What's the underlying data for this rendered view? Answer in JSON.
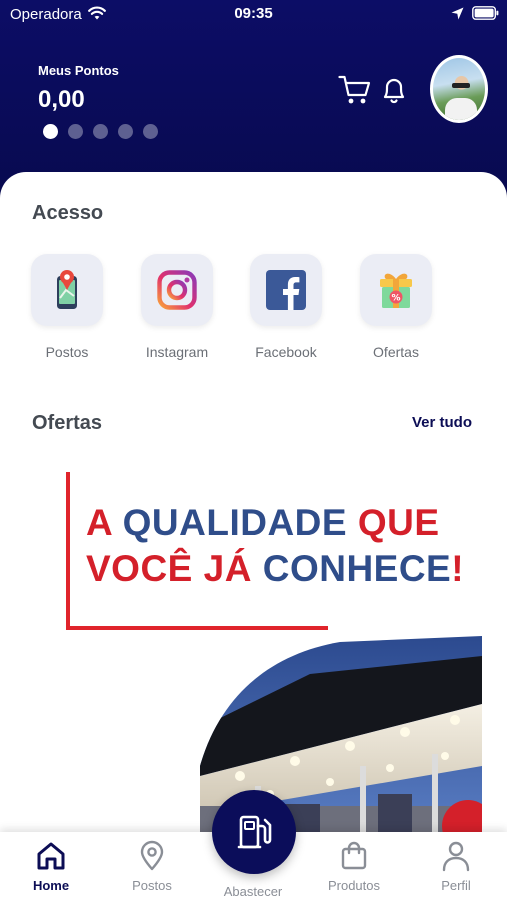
{
  "status_bar": {
    "carrier": "Operadora",
    "time": "09:35"
  },
  "header": {
    "points_label": "Meus Pontos",
    "points_value": "0,00",
    "carousel_pages": 5,
    "carousel_active": 0,
    "icons": [
      "cart-icon",
      "bell-icon"
    ],
    "avatar": "user-avatar"
  },
  "access": {
    "title": "Acesso",
    "items": [
      {
        "label": "Postos",
        "icon": "map-pin-phone-icon"
      },
      {
        "label": "Instagram",
        "icon": "instagram-icon"
      },
      {
        "label": "Facebook",
        "icon": "facebook-icon"
      },
      {
        "label": "Ofertas",
        "icon": "gift-icon"
      }
    ]
  },
  "offers": {
    "title": "Ofertas",
    "see_all": "Ver tudo",
    "banner": {
      "line1": [
        {
          "text": "A ",
          "tone": "red"
        },
        {
          "text": "QUALIDADE ",
          "tone": "blue"
        },
        {
          "text": "QUE",
          "tone": "red"
        }
      ],
      "line2": [
        {
          "text": "VOCÊ JÁ ",
          "tone": "red"
        },
        {
          "text": "CONHECE",
          "tone": "blue"
        },
        {
          "text": "!",
          "tone": "red"
        }
      ]
    }
  },
  "bottom_nav": {
    "items": [
      {
        "label": "Home",
        "icon": "home-icon",
        "active": true
      },
      {
        "label": "Postos",
        "icon": "location-pin-icon",
        "active": false
      },
      {
        "label": "Abastecer",
        "icon": "fuel-pump-icon",
        "active": false
      },
      {
        "label": "Produtos",
        "icon": "shopping-bag-icon",
        "active": false
      },
      {
        "label": "Perfil",
        "icon": "person-icon",
        "active": false
      }
    ]
  },
  "colors": {
    "header": "#0c0d66",
    "accent": "#0c0d55",
    "banner_red": "#d4202a",
    "banner_blue": "#2f4d8a"
  }
}
